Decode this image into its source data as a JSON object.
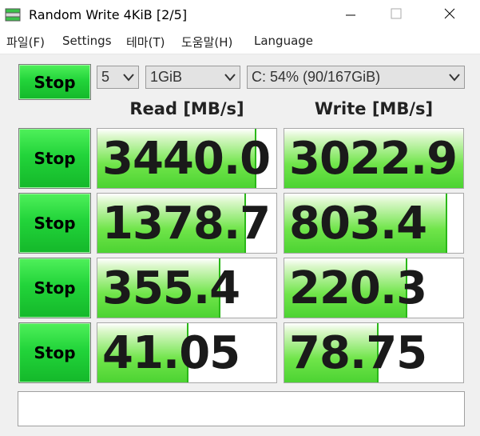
{
  "window": {
    "title": "Random Write 4KiB [2/5]",
    "app_icon": "disk-benchmark-icon"
  },
  "menu": {
    "items": [
      "파일(F)",
      "Settings",
      "테마(T)",
      "도움말(H)",
      "Language"
    ]
  },
  "controls": {
    "stop_all_label": "Stop",
    "count": "5",
    "size": "1GiB",
    "drive": "C: 54% (90/167GiB)"
  },
  "headers": {
    "read": "Read [MB/s]",
    "write": "Write [MB/s]"
  },
  "rows": [
    {
      "stop_label": "Stop",
      "read": "3440.0",
      "write": "3022.9",
      "read_fill": 0.88,
      "write_fill": 1.0
    },
    {
      "stop_label": "Stop",
      "read": "1378.7",
      "write": "803.4",
      "read_fill": 0.82,
      "write_fill": 0.9
    },
    {
      "stop_label": "Stop",
      "read": "355.4",
      "write": "220.3",
      "read_fill": 0.68,
      "write_fill": 0.68
    },
    {
      "stop_label": "Stop",
      "read": "41.05",
      "write": "78.75",
      "read_fill": 0.5,
      "write_fill": 0.52
    }
  ],
  "comment": "",
  "colors": {
    "button_green": "#22d43a",
    "bar_green": "#4cd332"
  }
}
